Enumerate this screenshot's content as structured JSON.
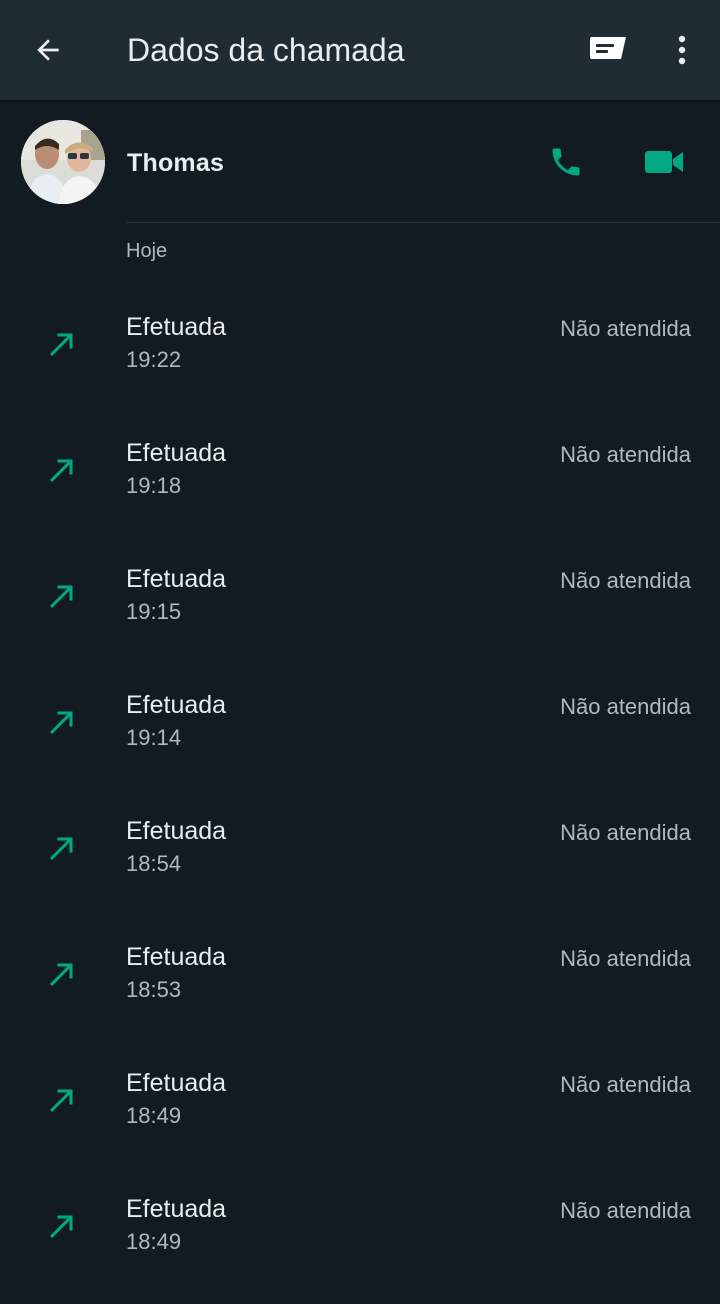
{
  "header": {
    "title": "Dados da chamada",
    "icons": {
      "back": "arrow-left-icon",
      "message": "message-icon",
      "more": "more-vertical-icon"
    }
  },
  "contact": {
    "name": "Thomas",
    "icons": {
      "voice": "phone-icon",
      "video": "video-camera-icon"
    }
  },
  "section": {
    "label": "Hoje"
  },
  "calls": [
    {
      "type": "Efetuada",
      "time": "19:22",
      "status": "Não atendida"
    },
    {
      "type": "Efetuada",
      "time": "19:18",
      "status": "Não atendida"
    },
    {
      "type": "Efetuada",
      "time": "19:15",
      "status": "Não atendida"
    },
    {
      "type": "Efetuada",
      "time": "19:14",
      "status": "Não atendida"
    },
    {
      "type": "Efetuada",
      "time": "18:54",
      "status": "Não atendida"
    },
    {
      "type": "Efetuada",
      "time": "18:53",
      "status": "Não atendida"
    },
    {
      "type": "Efetuada",
      "time": "18:49",
      "status": "Não atendida"
    },
    {
      "type": "Efetuada",
      "time": "18:49",
      "status": "Não atendida"
    }
  ],
  "colors": {
    "background": "#121b22",
    "header": "#1f2c34",
    "accent": "#00a884",
    "text_primary": "#e9edef",
    "text_secondary": "#aebac1"
  }
}
